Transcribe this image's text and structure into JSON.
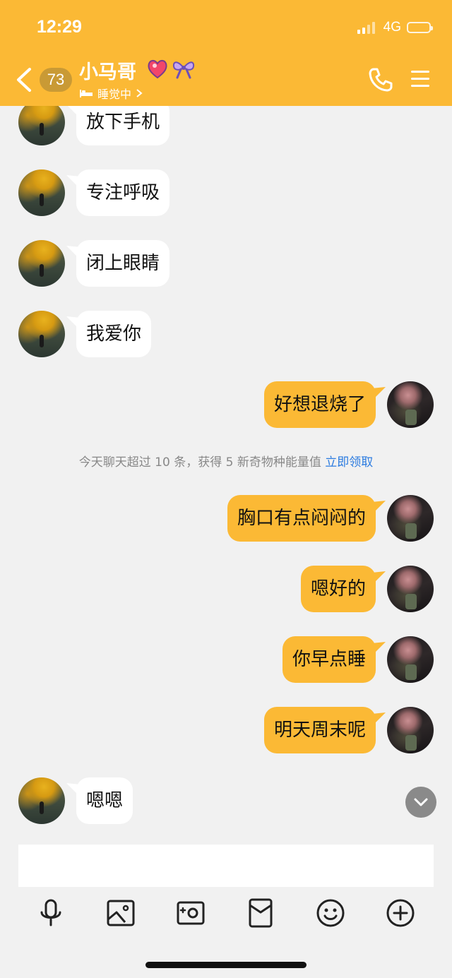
{
  "status_bar": {
    "time": "12:29",
    "network": "4G"
  },
  "header": {
    "unread_count": "73",
    "contact_name": "小马哥",
    "status": "睡觉中",
    "friend_icons": [
      "heart-flame-icon",
      "ribbon-bow-icon"
    ]
  },
  "messages": [
    {
      "side": "in",
      "text": "放下手机"
    },
    {
      "side": "in",
      "text": "专注呼吸"
    },
    {
      "side": "in",
      "text": "闭上眼睛"
    },
    {
      "side": "in",
      "text": "我爱你"
    },
    {
      "side": "out",
      "text": "好想退烧了"
    },
    {
      "side": "out",
      "text": "胸口有点闷闷的"
    },
    {
      "side": "out",
      "text": "嗯好的"
    },
    {
      "side": "out",
      "text": "你早点睡"
    },
    {
      "side": "out",
      "text": "明天周末呢"
    },
    {
      "side": "in",
      "text": "嗯嗯"
    }
  ],
  "system_notice": {
    "text": "今天聊天超过 10 条，获得 5 新奇物种能量值",
    "action": "立即领取"
  },
  "input": {
    "value": "",
    "placeholder": ""
  },
  "toolbar": [
    "microphone-icon",
    "picture-icon",
    "camera-icon",
    "red-packet-icon",
    "emoji-icon",
    "plus-icon"
  ],
  "colors": {
    "theme": "#fbb935",
    "outgoing_bubble": "#fbb935",
    "incoming_bubble": "#ffffff",
    "link": "#2b7be0"
  }
}
